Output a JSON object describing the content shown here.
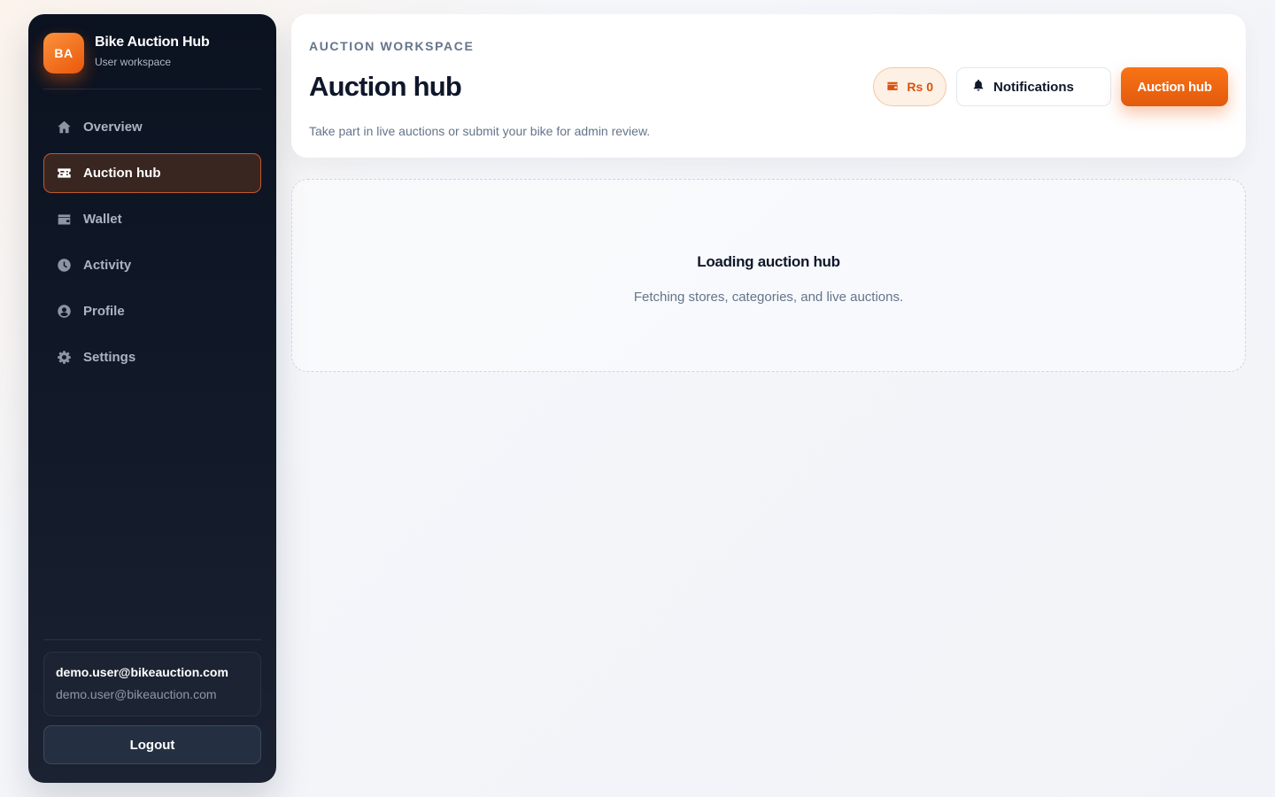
{
  "brand": {
    "initials": "BA",
    "title": "Bike Auction Hub",
    "subtitle": "User workspace"
  },
  "sidebar": {
    "items": [
      {
        "label": "Overview",
        "icon": "home-icon",
        "active": false
      },
      {
        "label": "Auction hub",
        "icon": "ticket-icon",
        "active": true
      },
      {
        "label": "Wallet",
        "icon": "wallet-icon",
        "active": false
      },
      {
        "label": "Activity",
        "icon": "clock-icon",
        "active": false
      },
      {
        "label": "Profile",
        "icon": "user-circle-icon",
        "active": false
      },
      {
        "label": "Settings",
        "icon": "gear-icon",
        "active": false
      }
    ]
  },
  "user": {
    "name": "demo.user@bikeauction.com",
    "email": "demo.user@bikeauction.com",
    "logout_label": "Logout"
  },
  "header": {
    "eyebrow": "AUCTION WORKSPACE",
    "title": "Auction hub",
    "description": "Take part in live auctions or submit your bike for admin review.",
    "balance": "Rs 0",
    "notifications_label": "Notifications",
    "primary_label": "Auction hub"
  },
  "loading": {
    "title": "Loading auction hub",
    "subtitle": "Fetching stores, categories, and live auctions."
  },
  "colors": {
    "accent": "#f97316",
    "sidebar_bg": "#0b1220",
    "active_nav_bg": "#3a2621",
    "active_nav_border": "#c2592a"
  }
}
